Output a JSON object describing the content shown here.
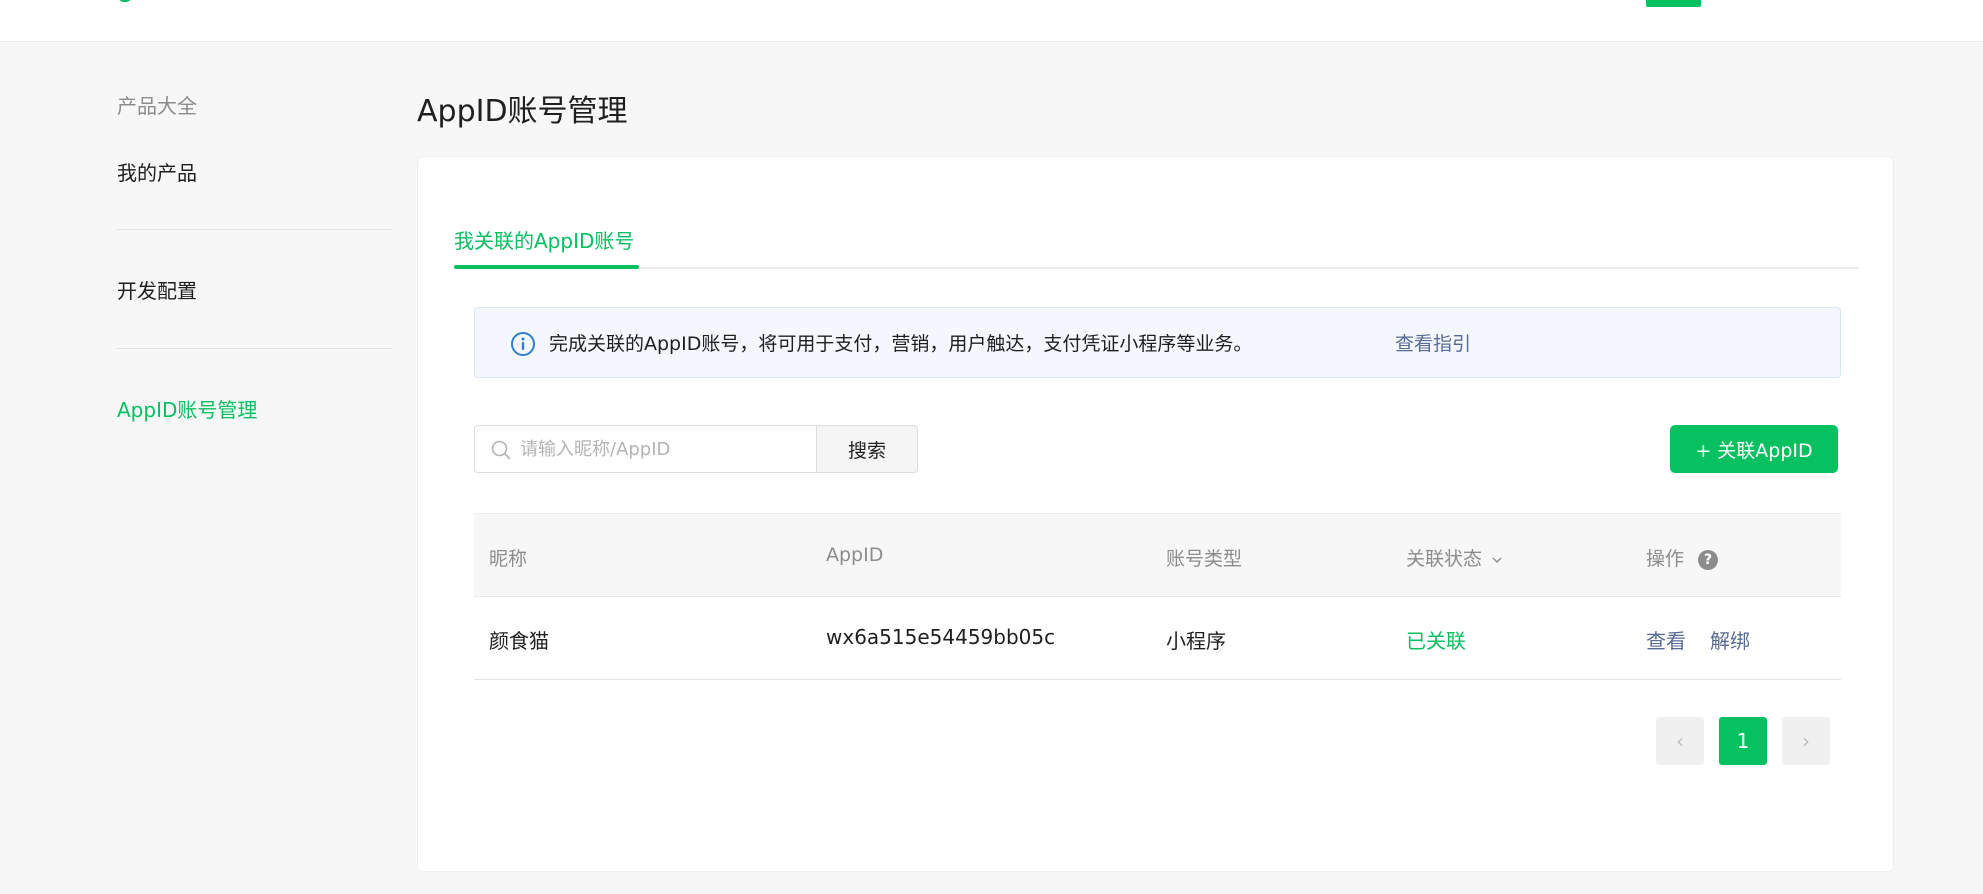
{
  "sidebar": {
    "heading": "产品大全",
    "items": [
      {
        "label": "我的产品"
      },
      {
        "label": "开发配置"
      },
      {
        "label": "AppID账号管理"
      }
    ]
  },
  "page": {
    "title": "AppID账号管理"
  },
  "tabs": [
    {
      "label": "我关联的AppID账号"
    }
  ],
  "notice": {
    "text": "完成关联的AppID账号，将可用于支付，营销，用户触达，支付凭证小程序等业务。",
    "link_label": "查看指引"
  },
  "search": {
    "placeholder": "请输入昵称/AppID",
    "value": "",
    "button_label": "搜索"
  },
  "add_button_label": "+ 关联AppID",
  "table": {
    "columns": [
      "昵称",
      "AppID",
      "账号类型",
      "关联状态",
      "操作"
    ],
    "rows": [
      {
        "nickname": "颜食猫",
        "appid": "wx6a515e54459bb05c",
        "type": "小程序",
        "status": "已关联",
        "actions": [
          "查看",
          "解绑"
        ]
      }
    ]
  },
  "pagination": {
    "prev": "‹",
    "current": "1",
    "next": "›"
  },
  "colors": {
    "accent": "#07c160",
    "link": "#576b95",
    "notice_bg": "#f4f8fe"
  },
  "icons": {
    "notice": "info-icon",
    "search": "search-icon",
    "status_sort": "chevron-down-icon",
    "actions_help": "help-icon"
  }
}
